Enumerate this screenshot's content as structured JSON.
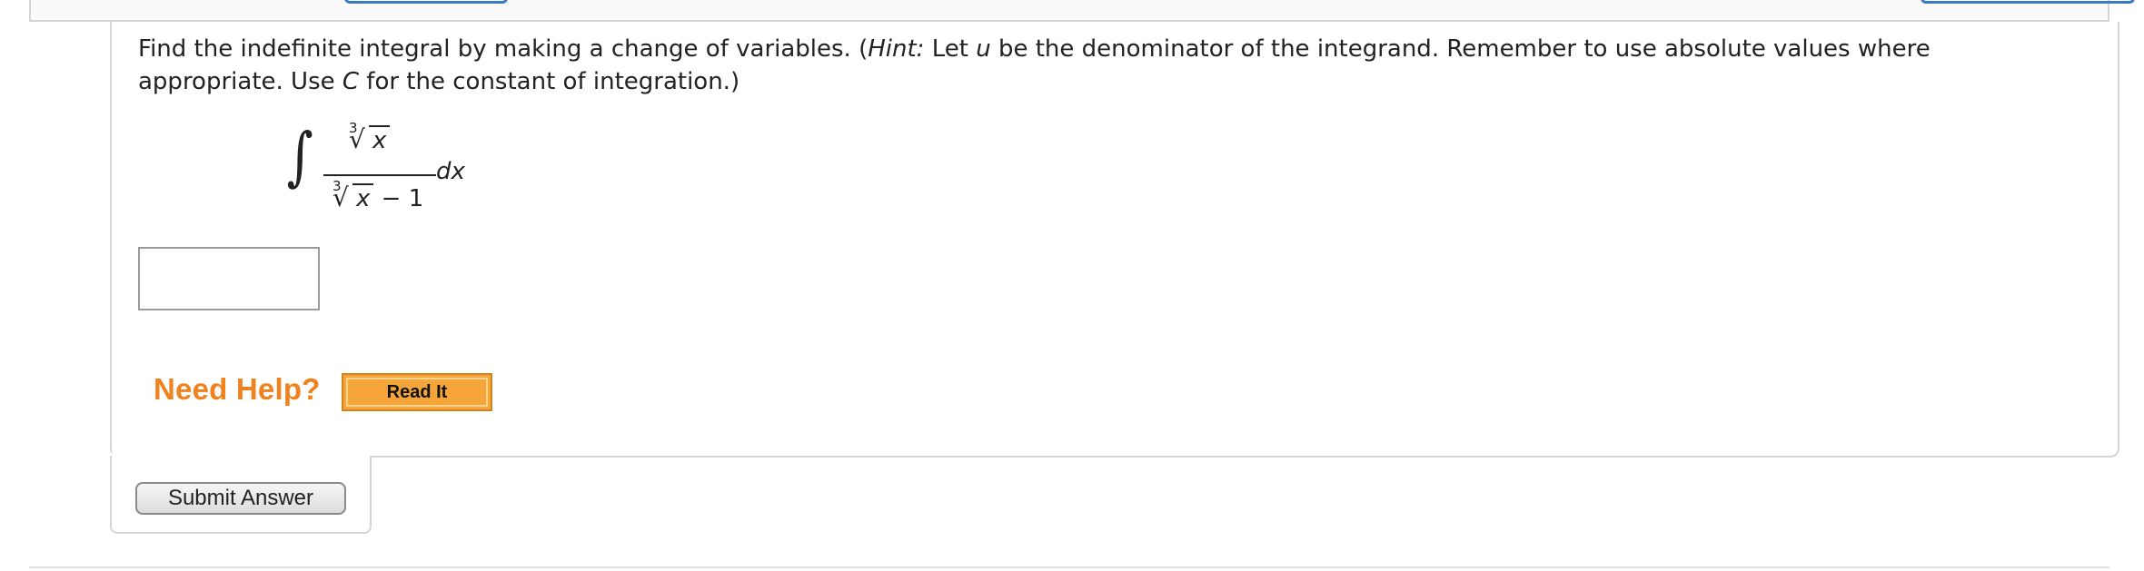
{
  "question": {
    "part1": "Find the indefinite integral by making a change of variables. (",
    "hint_label": "Hint:",
    "part2": " Let ",
    "var_u": "u",
    "part3": " be the denominator of the integrand. Remember to use absolute values where appropriate. Use ",
    "var_c": "C",
    "part4": " for the constant of integration.)"
  },
  "integral": {
    "symbol": "∫",
    "numerator_index": "3",
    "numerator_radicand": "x",
    "denominator_index": "3",
    "denominator_radicand": "x",
    "denominator_rest": " − 1",
    "differential": "dx"
  },
  "answer": {
    "value": ""
  },
  "help": {
    "label": "Need Help?",
    "read_it_label": "Read It"
  },
  "submit": {
    "label": "Submit Answer"
  },
  "colors": {
    "help_orange": "#f0821e",
    "read_it_bg": "#f5a53a",
    "tab_blue": "#3a7ac0"
  }
}
